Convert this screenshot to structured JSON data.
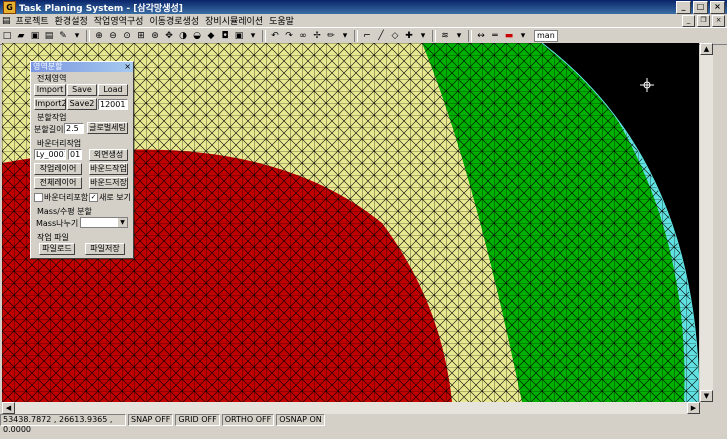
{
  "window": {
    "title": "Task Planing System - [삼각망생성]",
    "icon": "G"
  },
  "menu": [
    "프로젝트",
    "환경설정",
    "작업영역구성",
    "이동경로생성",
    "장비시뮬레이션",
    "도움말"
  ],
  "toolbar": {
    "man_label": "man"
  },
  "panel": {
    "title": "영역분할",
    "close": "×",
    "sec_total": "전체영역",
    "import": "Import",
    "save": "Save",
    "load": "Load",
    "import2": "Import2",
    "save2": "Save2",
    "field_12001": "12001",
    "sec_split": "분할작업",
    "split_len_label": "분할길이",
    "split_len_value": "2.5",
    "global_settings": "글로벌세팅",
    "sec_boundary": "바운더리작업",
    "ly_value": "Ly_0001",
    "num_value": "01",
    "face_create": "외면생성",
    "work_layer": "작업레이어",
    "boundary_work": "바운드작업",
    "total_layer": "전체레이어",
    "boundary_save": "바운드저장",
    "boundary_include": "바운더리포함",
    "new_view": "새로 보기",
    "sec_mass": "Mass/수평 분할",
    "mass_split": "Mass나누기",
    "sec_file": "작업 파일",
    "file_load": "파일로드",
    "file_save": "파일저장"
  },
  "status": {
    "coords": "53438.7872 , 26613.9365 , 0.0000",
    "snap": "SNAP OFF",
    "grid": "GRID OFF",
    "ortho": "ORTHO OFF",
    "osnap": "OSNAP ON"
  },
  "colors": {
    "red_region": "#c00000",
    "green_region": "#00b000",
    "yellow_grid": "#e8e890",
    "cyan_grid": "#60e0e0",
    "white_grid": "#ffffff"
  }
}
